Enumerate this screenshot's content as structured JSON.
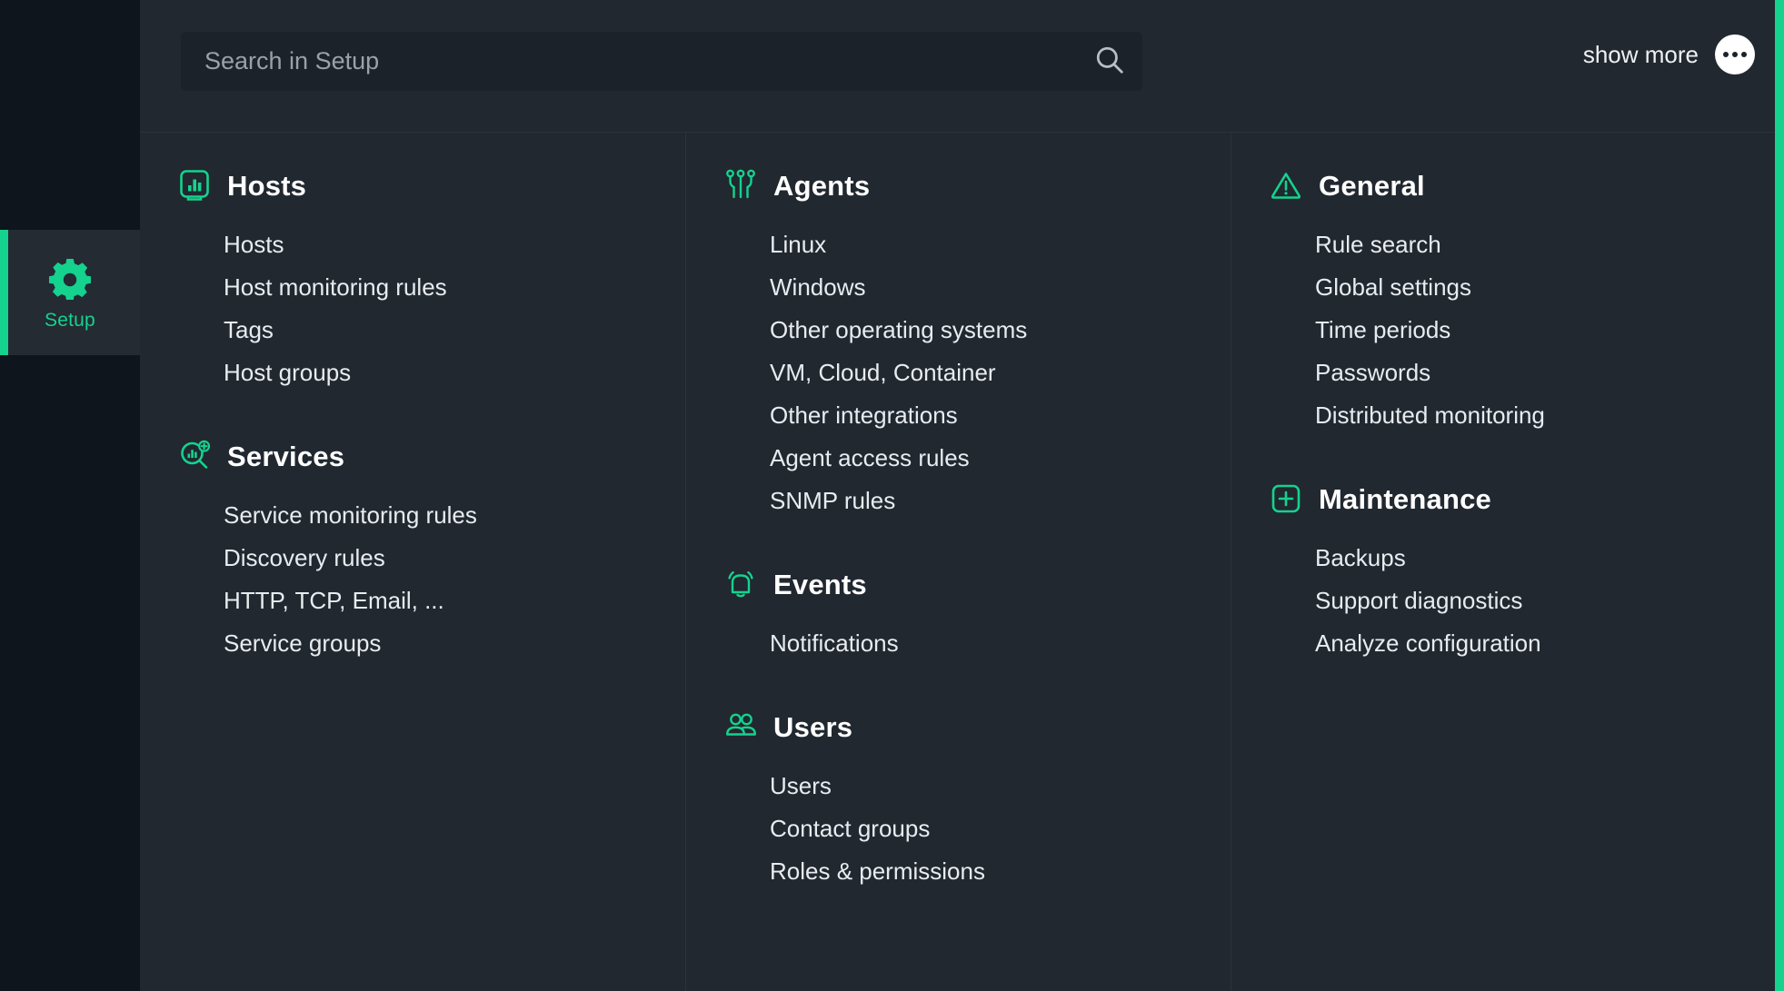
{
  "colors": {
    "accent": "#15d28e",
    "sidebar_bg": "#0f151c",
    "main_bg": "#212830",
    "search_bg": "#1c222a",
    "divider": "#2c333c",
    "text": "#e8ecf0"
  },
  "sidebar": {
    "items": [
      {
        "label": "Setup",
        "icon": "gear-icon",
        "active": true
      }
    ]
  },
  "header": {
    "search": {
      "placeholder": "Search in Setup",
      "value": "",
      "icon": "search-icon"
    },
    "show_more_label": "show more",
    "more_menu_icon": "ellipsis-icon"
  },
  "columns": [
    {
      "groups": [
        {
          "title": "Hosts",
          "icon": "host-chart-icon",
          "links": [
            "Hosts",
            "Host monitoring rules",
            "Tags",
            "Host groups"
          ]
        },
        {
          "title": "Services",
          "icon": "service-discovery-icon",
          "links": [
            "Service monitoring rules",
            "Discovery rules",
            "HTTP, TCP, Email, ...",
            "Service groups"
          ]
        }
      ]
    },
    {
      "groups": [
        {
          "title": "Agents",
          "icon": "agents-circuit-icon",
          "links": [
            "Linux",
            "Windows",
            "Other operating systems",
            "VM, Cloud, Container",
            "Other integrations",
            "Agent access rules",
            "SNMP rules"
          ]
        },
        {
          "title": "Events",
          "icon": "bell-icon",
          "links": [
            "Notifications"
          ]
        },
        {
          "title": "Users",
          "icon": "users-icon",
          "links": [
            "Users",
            "Contact groups",
            "Roles & permissions"
          ]
        }
      ]
    },
    {
      "groups": [
        {
          "title": "General",
          "icon": "warning-triangle-icon",
          "links": [
            "Rule search",
            "Global settings",
            "Time periods",
            "Passwords",
            "Distributed monitoring"
          ]
        },
        {
          "title": "Maintenance",
          "icon": "plus-square-icon",
          "links": [
            "Backups",
            "Support diagnostics",
            "Analyze configuration"
          ]
        }
      ]
    }
  ]
}
